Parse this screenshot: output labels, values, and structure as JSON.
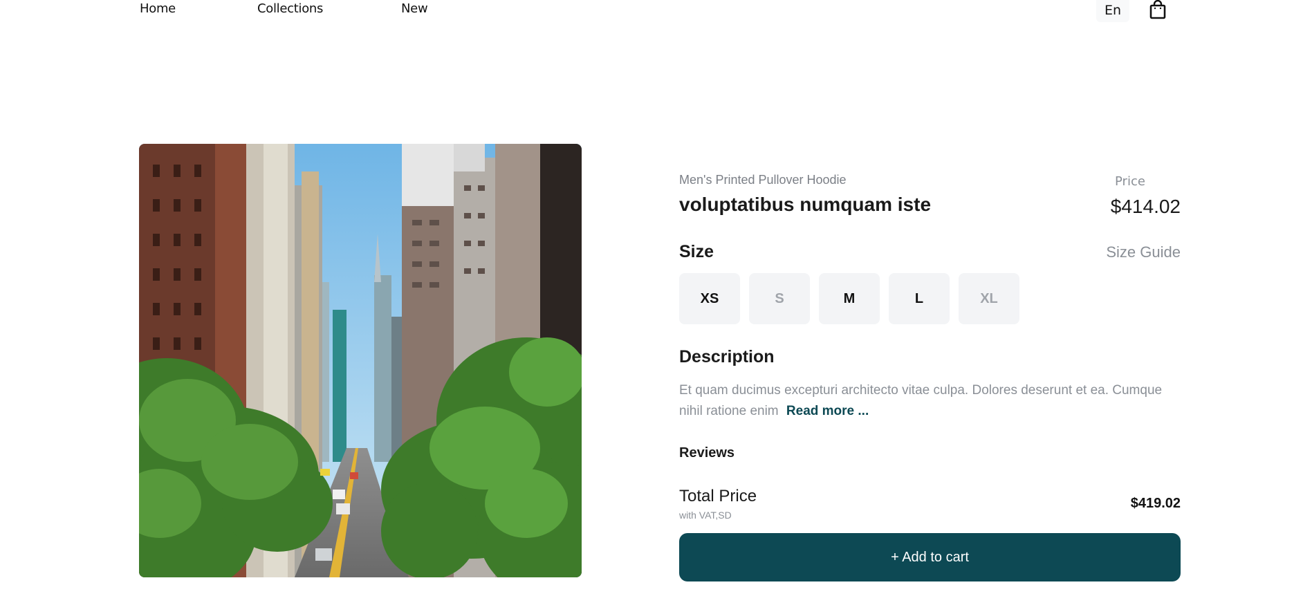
{
  "nav": {
    "links": [
      "Home",
      "Collections",
      "New"
    ],
    "language": "En"
  },
  "product": {
    "subtitle": "Men's Printed Pullover Hoodie",
    "name": "voluptatibus numquam iste",
    "price_label": "Price",
    "price": "$414.02",
    "image_desc": "city-street-photo"
  },
  "size": {
    "heading": "Size",
    "guide_label": "Size Guide",
    "options": [
      {
        "label": "XS",
        "available": true
      },
      {
        "label": "S",
        "available": false
      },
      {
        "label": "M",
        "available": true
      },
      {
        "label": "L",
        "available": true
      },
      {
        "label": "XL",
        "available": false
      }
    ]
  },
  "description": {
    "heading": "Description",
    "text": "Et quam ducimus excepturi architecto vitae culpa. Dolores deserunt et ea. Cumque nihil ratione enim",
    "read_more": "Read more ..."
  },
  "reviews": {
    "heading": "Reviews"
  },
  "total": {
    "label": "Total Price",
    "sub": "with VAT,SD",
    "price": "$419.02"
  },
  "cart": {
    "button_label": "+ Add to cart"
  },
  "colors": {
    "accent": "#0d4954",
    "muted": "#8a8f96",
    "size_bg": "#f3f4f6"
  }
}
